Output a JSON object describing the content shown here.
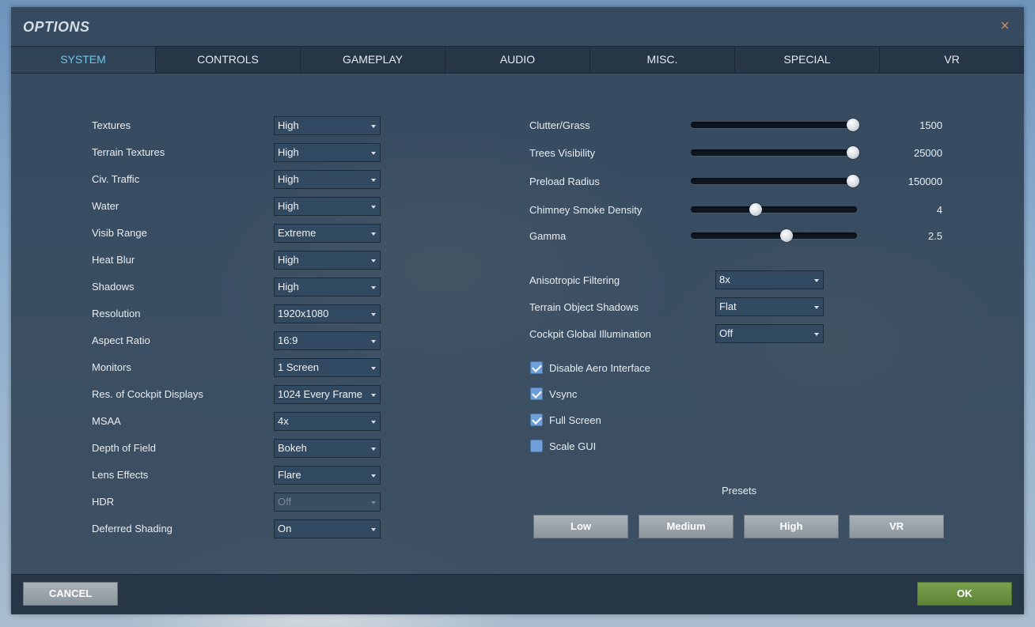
{
  "window": {
    "title": "OPTIONS",
    "close_glyph": "×"
  },
  "tabs": [
    "SYSTEM",
    "CONTROLS",
    "GAMEPLAY",
    "AUDIO",
    "MISC.",
    "SPECIAL",
    "VR"
  ],
  "active_tab": "SYSTEM",
  "left_settings": [
    {
      "label": "Textures",
      "value": "High",
      "enabled": true
    },
    {
      "label": "Terrain Textures",
      "value": "High",
      "enabled": true
    },
    {
      "label": "Civ. Traffic",
      "value": "High",
      "enabled": true
    },
    {
      "label": "Water",
      "value": "High",
      "enabled": true
    },
    {
      "label": "Visib Range",
      "value": "Extreme",
      "enabled": true
    },
    {
      "label": "Heat Blur",
      "value": "High",
      "enabled": true
    },
    {
      "label": "Shadows",
      "value": "High",
      "enabled": true
    },
    {
      "label": "Resolution",
      "value": "1920x1080",
      "enabled": true
    },
    {
      "label": "Aspect Ratio",
      "value": "16:9",
      "enabled": true
    },
    {
      "label": "Monitors",
      "value": "1 Screen",
      "enabled": true
    },
    {
      "label": "Res. of Cockpit Displays",
      "value": "1024 Every Frame",
      "enabled": true
    },
    {
      "label": "MSAA",
      "value": "4x",
      "enabled": true
    },
    {
      "label": "Depth of Field",
      "value": "Bokeh",
      "enabled": true
    },
    {
      "label": "Lens Effects",
      "value": "Flare",
      "enabled": true
    },
    {
      "label": "HDR",
      "value": "Off",
      "enabled": false
    },
    {
      "label": "Deferred Shading",
      "value": "On",
      "enabled": true
    }
  ],
  "sliders": [
    {
      "label": "Clutter/Grass",
      "value": "1500",
      "fraction": 1.0
    },
    {
      "label": "Trees Visibility",
      "value": "25000",
      "fraction": 1.0
    },
    {
      "label": "Preload Radius",
      "value": "150000",
      "fraction": 1.0
    },
    {
      "label": "Chimney Smoke Density",
      "value": "4",
      "fraction": 0.4
    },
    {
      "label": "Gamma",
      "value": "2.5",
      "fraction": 0.59
    }
  ],
  "right_settings": [
    {
      "label": "Anisotropic Filtering",
      "value": "8x"
    },
    {
      "label": "Terrain Object Shadows",
      "value": "Flat"
    },
    {
      "label": "Cockpit Global Illumination",
      "value": "Off"
    }
  ],
  "checkboxes": [
    {
      "label": "Disable Aero Interface",
      "checked": true
    },
    {
      "label": "Vsync",
      "checked": true
    },
    {
      "label": "Full Screen",
      "checked": true
    },
    {
      "label": "Scale GUI",
      "checked": false
    }
  ],
  "presets": {
    "title": "Presets",
    "buttons": [
      "Low",
      "Medium",
      "High",
      "VR"
    ]
  },
  "footer": {
    "cancel_label": "CANCEL",
    "ok_label": "OK"
  },
  "colors": {
    "accent_tab": "#6fc6e8",
    "ok_button": "#6b9442",
    "checkbox": "#6f9fd8",
    "close_icon": "#c98a5a"
  }
}
